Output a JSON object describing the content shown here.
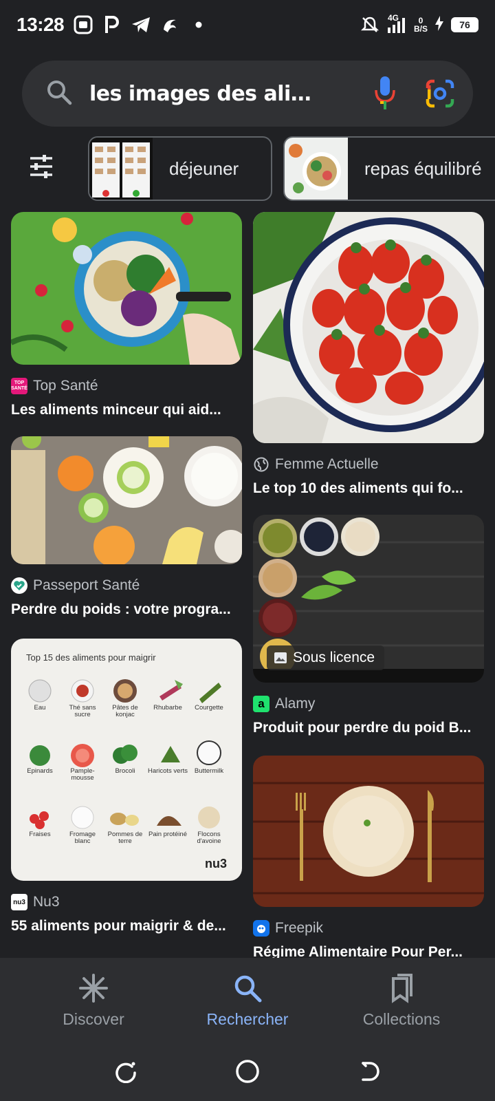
{
  "status_bar": {
    "time": "13:28",
    "network_top": "4G",
    "speed_value": "0",
    "speed_unit": "B/S",
    "battery": "76"
  },
  "search": {
    "query": "les images des aliment...",
    "search_icon": "search-icon",
    "mic_icon": "mic-icon",
    "lens_icon": "google-lens-icon"
  },
  "chips": [
    {
      "label": "déjeuner"
    },
    {
      "label": "repas équilibré"
    }
  ],
  "results": [
    {
      "source": "Top Santé",
      "favicon_text": "Top Santé",
      "title": "Les aliments minceur qui aid..."
    },
    {
      "source": "Femme Actuelle",
      "title": "Le top 10 des aliments qui fo..."
    },
    {
      "source": "Passeport Santé",
      "title": "Perdre du poids : votre progra..."
    },
    {
      "source": "Alamy",
      "favicon_text": "a",
      "title": "Produit pour perdre du poid B...",
      "badge": "Sous licence"
    },
    {
      "source": "Nu3",
      "favicon_text": "nu3",
      "title": "55 aliments pour maigrir & de..."
    },
    {
      "source": "Freepik",
      "title": "Régime Alimentaire Pour Per..."
    }
  ],
  "infographic": {
    "title": "Top 15 des aliments pour maigrir",
    "items": [
      "Eau",
      "Thé sans sucre",
      "Pâtes de konjac",
      "Rhubarbe",
      "Courgette",
      "Epinards",
      "Pample-mousse",
      "Brocoli",
      "Haricots verts",
      "Buttermilk",
      "Fraises",
      "Fromage blanc",
      "Pommes de terre",
      "Pain protéiné",
      "Flocons d'avoine"
    ],
    "brand": "nu3"
  },
  "bottom_nav": [
    {
      "label": "Discover",
      "active": false
    },
    {
      "label": "Rechercher",
      "active": true
    },
    {
      "label": "Collections",
      "active": false
    }
  ],
  "colors": {
    "background": "#202124",
    "active_nav": "#8ab4f8",
    "inactive_nav": "#9aa0a6"
  }
}
